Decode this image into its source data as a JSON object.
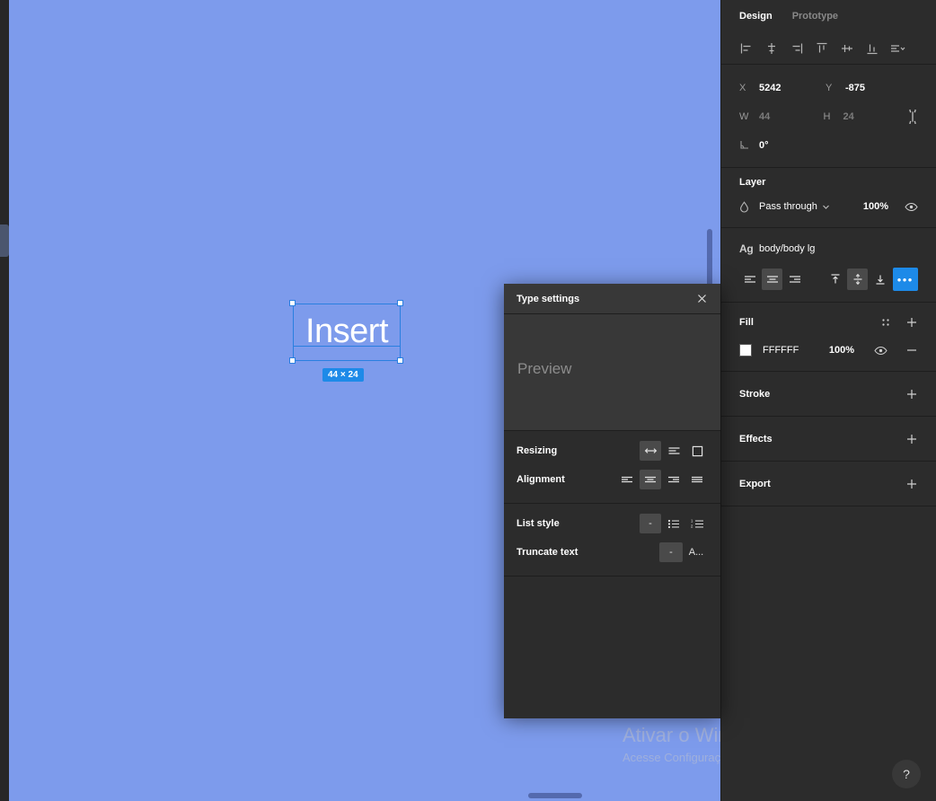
{
  "canvas": {
    "background_color": "#7d9bec",
    "selection": {
      "text": "Insert",
      "size_badge": "44 × 24",
      "accent_color": "#2a7fe0"
    }
  },
  "watermark": {
    "title": "Ativar o Windows",
    "subtitle": "Acesse Configurações para ativar o Windows."
  },
  "right_panel": {
    "tabs": [
      {
        "label": "Design",
        "active": true
      },
      {
        "label": "Prototype",
        "active": false
      }
    ],
    "align_toolbar": [
      {
        "name": "align-left-icon",
        "title": "Align left"
      },
      {
        "name": "align-horizontal-centers-icon",
        "title": "Align horizontal centers"
      },
      {
        "name": "align-right-icon",
        "title": "Align right"
      },
      {
        "name": "align-top-icon",
        "title": "Align top"
      },
      {
        "name": "align-vertical-centers-icon",
        "title": "Align vertical centers"
      },
      {
        "name": "align-bottom-icon",
        "title": "Align bottom"
      },
      {
        "name": "distribute-icon",
        "title": "Tidy up"
      }
    ],
    "position": {
      "x_label": "X",
      "x_value": "5242",
      "y_label": "Y",
      "y_value": "-875",
      "w_label": "W",
      "w_value": "44",
      "h_label": "H",
      "h_value": "24",
      "rotation_value": "0°"
    },
    "layer": {
      "title": "Layer",
      "blend_mode": "Pass through",
      "opacity": "100%"
    },
    "typography": {
      "icon": "Ag",
      "style_name": "body/body lg",
      "horizontal_align": [
        "left",
        "center",
        "right"
      ],
      "horizontal_selected": 1,
      "vertical_align": [
        "top",
        "middle",
        "bottom"
      ],
      "vertical_selected": 1,
      "more_label": "•••"
    },
    "fill": {
      "title": "Fill",
      "hex": "FFFFFF",
      "opacity": "100%",
      "swatch_color": "#FFFFFF"
    },
    "stroke": {
      "title": "Stroke"
    },
    "effects": {
      "title": "Effects"
    },
    "export": {
      "title": "Export"
    },
    "help_label": "?"
  },
  "type_settings_dialog": {
    "title": "Type settings",
    "preview_label": "Preview",
    "rows": [
      {
        "label": "Resizing",
        "options": [
          "auto-width",
          "auto-height",
          "fixed-size"
        ],
        "selected": 0
      },
      {
        "label": "Alignment",
        "options": [
          "align-left",
          "align-center",
          "align-right",
          "align-justified"
        ],
        "selected": 1
      },
      {
        "label": "List style",
        "options": [
          "-",
          "bulleted-list",
          "numbered-list"
        ],
        "selected": 0
      },
      {
        "label": "Truncate text",
        "options": [
          "-",
          "A..."
        ],
        "selected": 0
      }
    ]
  }
}
